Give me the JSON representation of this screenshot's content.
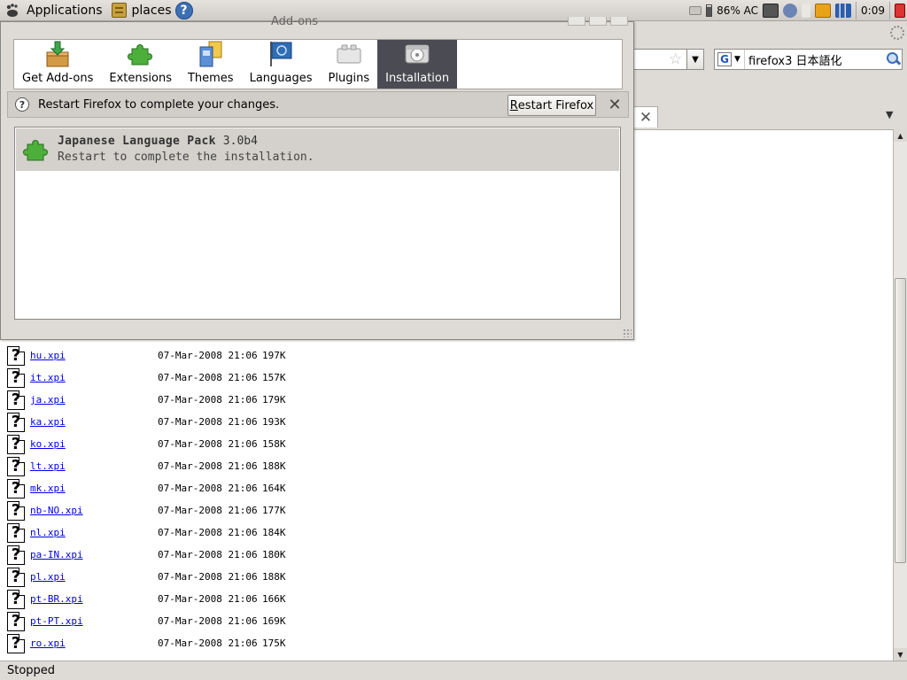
{
  "panel": {
    "applications_label": "Applications",
    "places_label": "places",
    "help_glyph": "?",
    "battery_text": "86% AC",
    "clock": "0:09",
    "icons": [
      "gnome-foot-icon",
      "places-icon",
      "help-icon",
      "disk-icon",
      "battery-icon",
      "camera-icon",
      "network-icon",
      "crown-icon",
      "signal-icon",
      "logout-icon"
    ]
  },
  "dialog": {
    "title": "Add-ons",
    "toolbar": [
      {
        "label": "Get Add-ons",
        "name": "tab-get-addons",
        "icon": "package-icon",
        "selected": false
      },
      {
        "label": "Extensions",
        "name": "tab-extensions",
        "icon": "puzzle-icon",
        "selected": false
      },
      {
        "label": "Themes",
        "name": "tab-themes",
        "icon": "themes-icon",
        "selected": false
      },
      {
        "label": "Languages",
        "name": "tab-languages",
        "icon": "flag-icon",
        "selected": false
      },
      {
        "label": "Plugins",
        "name": "tab-plugins",
        "icon": "plugin-icon",
        "selected": false
      },
      {
        "label": "Installation",
        "name": "tab-installation",
        "icon": "install-disc-icon",
        "selected": true
      }
    ],
    "notification": {
      "text": "Restart Firefox to complete your changes.",
      "button_first": "R",
      "button_rest": "estart Firefox",
      "close_glyph": "✕"
    },
    "addon": {
      "name": "Japanese Language Pack",
      "version": "3.0b4",
      "status": "Restart to complete the installation."
    }
  },
  "browser": {
    "search_text": "firefox3 日本語化",
    "engine_glyph": "G",
    "tab_close_glyph": "✕",
    "status": "Stopped"
  },
  "files": [
    {
      "name": "hu.xpi",
      "date": "07-Mar-2008 21:06",
      "size": "197K"
    },
    {
      "name": "it.xpi",
      "date": "07-Mar-2008 21:06",
      "size": "157K"
    },
    {
      "name": "ja.xpi",
      "date": "07-Mar-2008 21:06",
      "size": "179K"
    },
    {
      "name": "ka.xpi",
      "date": "07-Mar-2008 21:06",
      "size": "193K"
    },
    {
      "name": "ko.xpi",
      "date": "07-Mar-2008 21:06",
      "size": "158K"
    },
    {
      "name": "lt.xpi",
      "date": "07-Mar-2008 21:06",
      "size": "188K"
    },
    {
      "name": "mk.xpi",
      "date": "07-Mar-2008 21:06",
      "size": "164K"
    },
    {
      "name": "nb-NO.xpi",
      "date": "07-Mar-2008 21:06",
      "size": "177K"
    },
    {
      "name": "nl.xpi",
      "date": "07-Mar-2008 21:06",
      "size": "184K"
    },
    {
      "name": "pa-IN.xpi",
      "date": "07-Mar-2008 21:06",
      "size": "180K"
    },
    {
      "name": "pl.xpi",
      "date": "07-Mar-2008 21:06",
      "size": "188K"
    },
    {
      "name": "pt-BR.xpi",
      "date": "07-Mar-2008 21:06",
      "size": "166K"
    },
    {
      "name": "pt-PT.xpi",
      "date": "07-Mar-2008 21:06",
      "size": "169K"
    },
    {
      "name": "ro.xpi",
      "date": "07-Mar-2008 21:06",
      "size": "175K"
    }
  ],
  "colors": {
    "link": "#0000ee",
    "selected_tab": "#4b4b53",
    "panel": "#dedbd7"
  }
}
